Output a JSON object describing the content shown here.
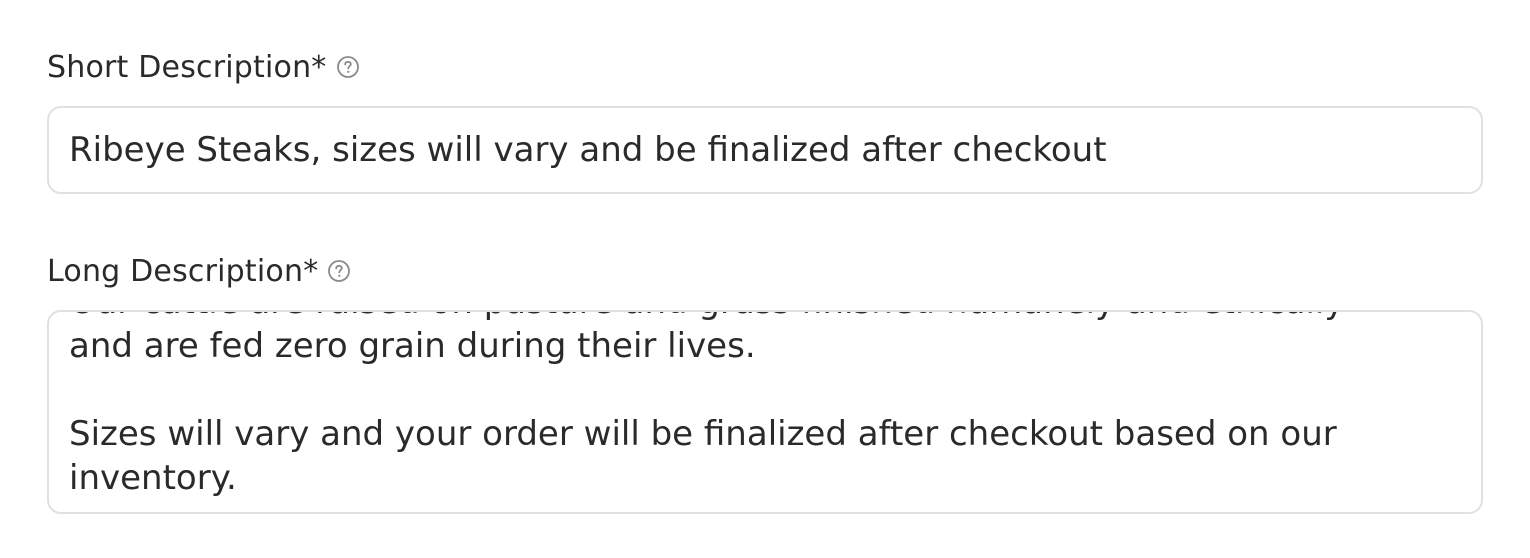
{
  "short_description": {
    "label": "Short Description*",
    "help_icon": "question-circle-icon",
    "value": "Ribeye Steaks, sizes will vary and be finalized after checkout"
  },
  "long_description": {
    "label": "Long Description*",
    "help_icon": "question-circle-icon",
    "value": "Our cattle are raised on pasture and grass finished humanely and ethically\nand are fed zero grain during their lives.\n\nSizes will vary and your order will be finalized after checkout based on our\ninventory."
  }
}
